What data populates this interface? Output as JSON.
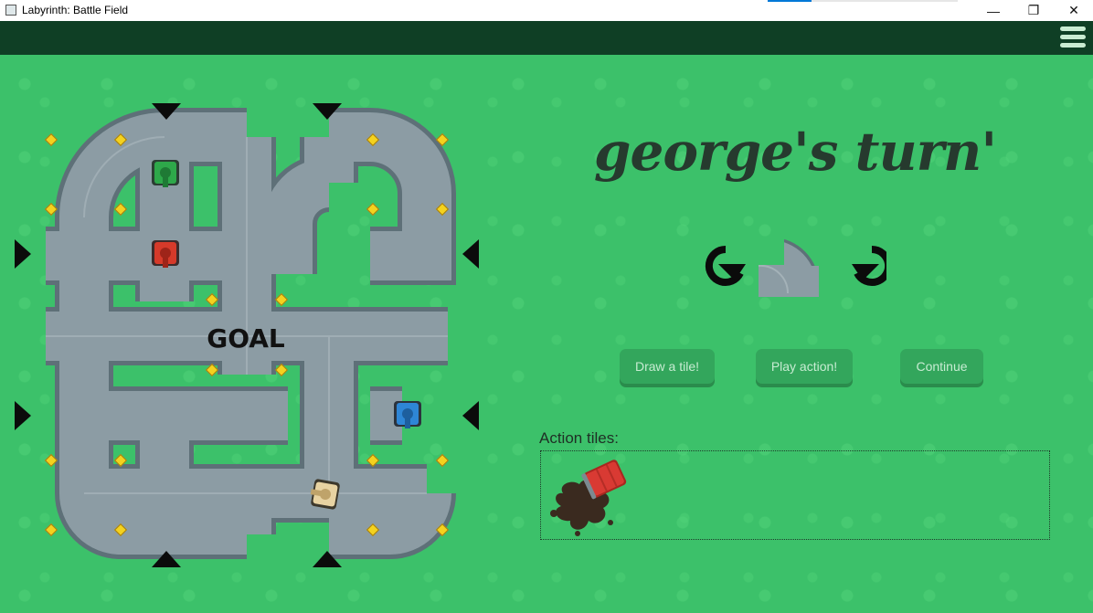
{
  "window": {
    "title": "Labyrinth: Battle Field",
    "minimize_glyph": "—",
    "maximize_glyph": "❐",
    "close_glyph": "✕"
  },
  "board": {
    "goal_label": "GOAL"
  },
  "turn": {
    "title": "george's turn'"
  },
  "buttons": {
    "draw_tile": "Draw a tile!",
    "play_action": "Play action!",
    "continue": "Continue"
  },
  "action_tiles": {
    "label": "Action tiles:"
  },
  "colors": {
    "grass": "#3cc16a",
    "topbar": "#0f3f25",
    "road": "#8a9aa2",
    "road_edge": "#5f7178",
    "button": "#33a65c",
    "tank_green": "#2ea84a",
    "tank_red": "#d63a2a",
    "tank_blue": "#2e86d6",
    "tank_beige": "#e8d3a2",
    "barrel_red": "#d93a33",
    "oil": "#3a2a1f"
  }
}
